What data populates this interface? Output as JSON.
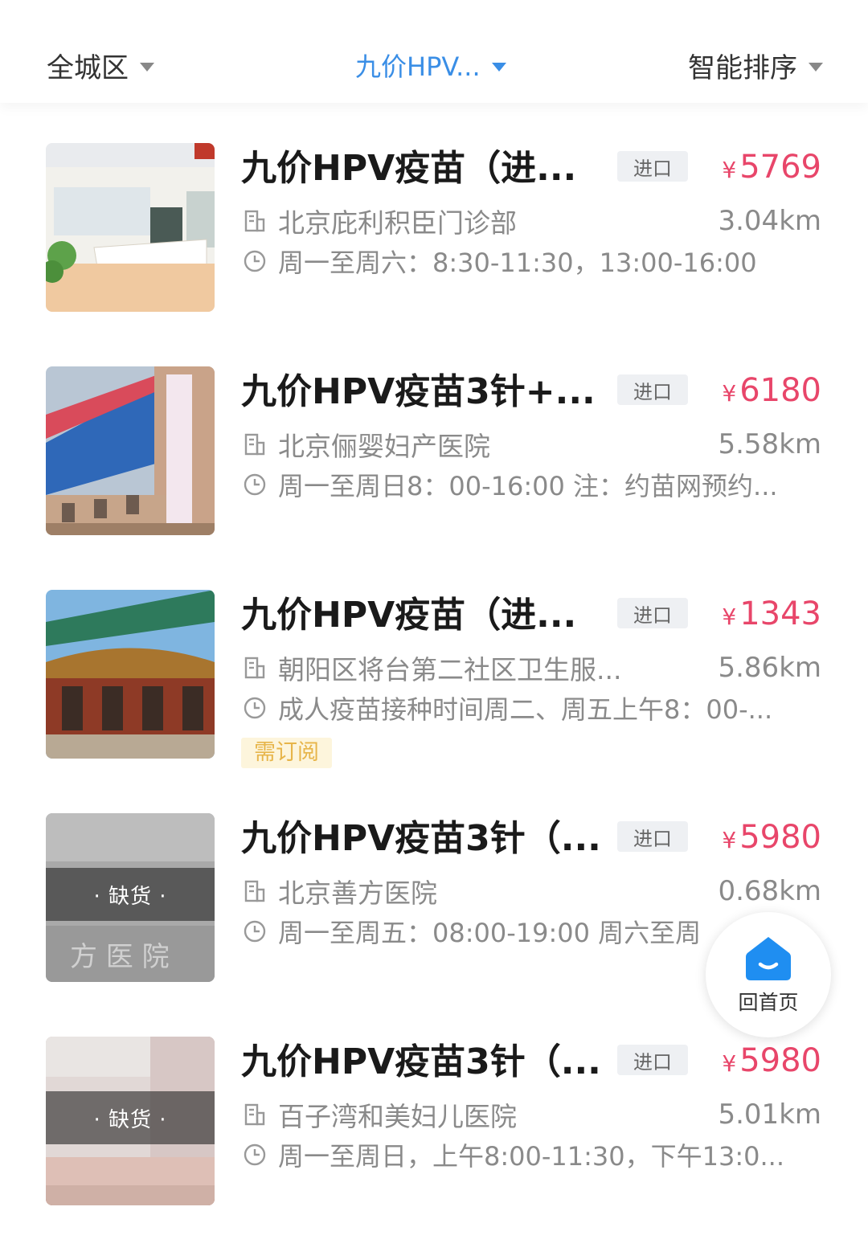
{
  "filters": {
    "district": "全城区",
    "product": "九价HPV...",
    "sort": "智能排序"
  },
  "colors": {
    "accent": "#3a8ee6",
    "price": "#e8466a",
    "subscribe_text": "#e7b54a",
    "subscribe_bg": "#fdf5dc"
  },
  "icons": {
    "dropdown": "triangle-down-icon",
    "address": "building-icon",
    "hours": "clock-icon",
    "home": "home-icon"
  },
  "items": [
    {
      "title": "九价HPV疫苗（进...",
      "badge": "进口",
      "currency": "¥",
      "price": "5769",
      "address": "北京庇利积臣门诊部",
      "distance": "3.04km",
      "hours": "周一至周六：8:30-11:30，13:00-16:00"
    },
    {
      "title": "九价HPV疫苗3针+...",
      "badge": "进口",
      "currency": "¥",
      "price": "6180",
      "address": "北京俪婴妇产医院",
      "distance": "5.58km",
      "hours": "周一至周日8：00-16:00 注：约苗网预约..."
    },
    {
      "title": "九价HPV疫苗（进...",
      "badge": "进口",
      "currency": "¥",
      "price": "1343",
      "address": "朝阳区将台第二社区卫生服...",
      "distance": "5.86km",
      "hours": "成人疫苗接种时间周二、周五上午8：00-...",
      "tag": "需订阅"
    },
    {
      "title": "九价HPV疫苗3针（...",
      "badge": "进口",
      "currency": "¥",
      "price": "5980",
      "address": "北京善方医院",
      "distance": "0.68km",
      "hours": "周一至周五：08:00-19:00 周六至周",
      "stock": "· 缺货 ·"
    },
    {
      "title": "九价HPV疫苗3针（...",
      "badge": "进口",
      "currency": "¥",
      "price": "5980",
      "address": "百子湾和美妇儿医院",
      "distance": "5.01km",
      "hours": "周一至周日，上午8:00-11:30，下午13:0...",
      "stock": "· 缺货 ·"
    }
  ],
  "home_button": {
    "label": "回首页"
  }
}
